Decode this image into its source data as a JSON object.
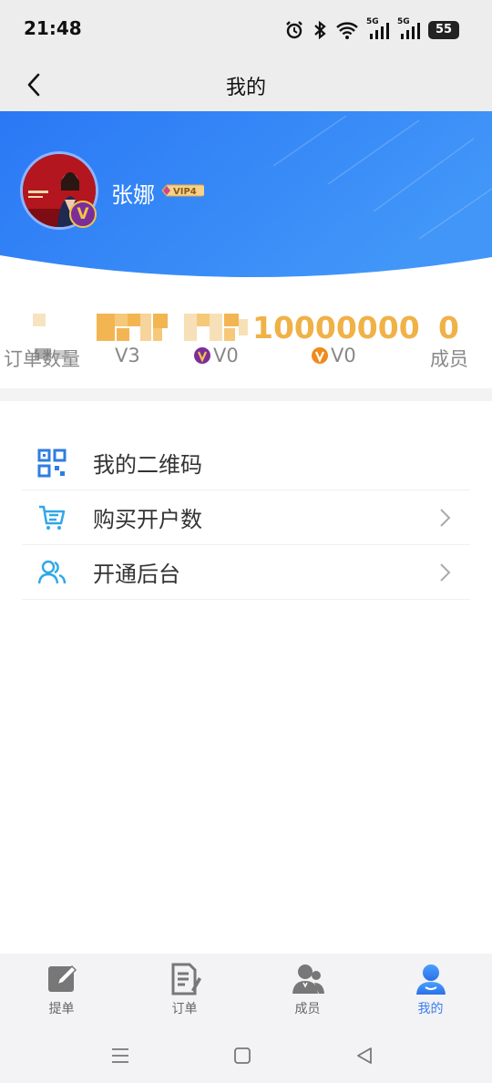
{
  "status": {
    "time": "21:48",
    "net1": "5G",
    "net2": "5G",
    "battery": "55"
  },
  "nav": {
    "title": "我的",
    "back_icon": "chevron-left-icon"
  },
  "profile": {
    "name": "张娜",
    "vip_badge": "VIP4",
    "avatar_badge": "V",
    "banner_gradient": [
      "#2b7cf6",
      "#3f93f8"
    ]
  },
  "stats": [
    {
      "value": "",
      "label": "订单数量",
      "redacted": true
    },
    {
      "value": "",
      "label": "V3",
      "redacted": true
    },
    {
      "value": "",
      "label": "V0",
      "redacted": true,
      "badge_color": "#7b2d9a"
    },
    {
      "value": "10000000",
      "label": "V0",
      "badge_color": "#f08a1c"
    },
    {
      "value": "0",
      "label": "成员"
    }
  ],
  "menu": [
    {
      "label": "我的二维码",
      "icon": "qr-code-icon",
      "arrow": false
    },
    {
      "label": "购买开户数",
      "icon": "cart-icon",
      "arrow": true
    },
    {
      "label": "开通后台",
      "icon": "users-icon",
      "arrow": true
    }
  ],
  "tabs": [
    {
      "label": "提单",
      "icon": "edit-icon",
      "active": false
    },
    {
      "label": "订单",
      "icon": "document-icon",
      "active": false
    },
    {
      "label": "成员",
      "icon": "members-icon",
      "active": false
    },
    {
      "label": "我的",
      "icon": "person-icon",
      "active": true
    }
  ],
  "colors": {
    "accent": "#3a7df0",
    "stat_value": "#f0b146",
    "icon_blue": "#2f7de1"
  }
}
